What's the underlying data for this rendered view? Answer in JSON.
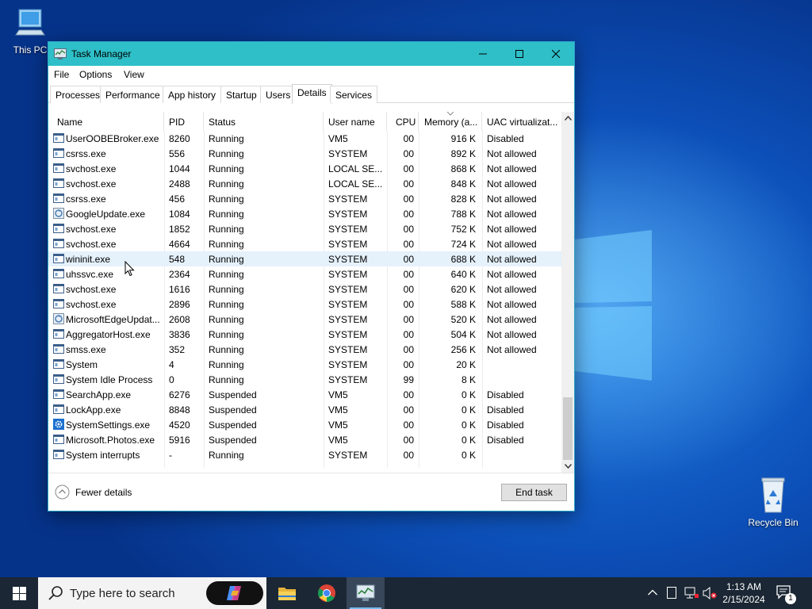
{
  "desktop": {
    "icons": [
      {
        "label": "This PC",
        "icon": "computer-icon"
      },
      {
        "label": "Recycle Bin",
        "icon": "recycle-bin-icon"
      }
    ]
  },
  "window": {
    "title": "Task Manager",
    "accent": "#2ebfc8",
    "menu": [
      "File",
      "Options",
      "View"
    ],
    "tabs": [
      "Processes",
      "Performance",
      "App history",
      "Startup",
      "Users",
      "Details",
      "Services"
    ],
    "active_tab": "Details",
    "columns": [
      "Name",
      "PID",
      "Status",
      "User name",
      "CPU",
      "Memory (a...",
      "UAC virtualizat..."
    ],
    "rows": [
      {
        "name": "UserOOBEBroker.exe",
        "pid": "8260",
        "status": "Running",
        "user": "VM5",
        "cpu": "00",
        "mem": "916 K",
        "uac": "Disabled",
        "icon": "window-icon"
      },
      {
        "name": "csrss.exe",
        "pid": "556",
        "status": "Running",
        "user": "SYSTEM",
        "cpu": "00",
        "mem": "892 K",
        "uac": "Not allowed",
        "icon": "window-icon"
      },
      {
        "name": "svchost.exe",
        "pid": "1044",
        "status": "Running",
        "user": "LOCAL SE...",
        "cpu": "00",
        "mem": "868 K",
        "uac": "Not allowed",
        "icon": "window-icon"
      },
      {
        "name": "svchost.exe",
        "pid": "2488",
        "status": "Running",
        "user": "LOCAL SE...",
        "cpu": "00",
        "mem": "848 K",
        "uac": "Not allowed",
        "icon": "window-icon"
      },
      {
        "name": "csrss.exe",
        "pid": "456",
        "status": "Running",
        "user": "SYSTEM",
        "cpu": "00",
        "mem": "828 K",
        "uac": "Not allowed",
        "icon": "window-icon"
      },
      {
        "name": "GoogleUpdate.exe",
        "pid": "1084",
        "status": "Running",
        "user": "SYSTEM",
        "cpu": "00",
        "mem": "788 K",
        "uac": "Not allowed",
        "icon": "updater-icon"
      },
      {
        "name": "svchost.exe",
        "pid": "1852",
        "status": "Running",
        "user": "SYSTEM",
        "cpu": "00",
        "mem": "752 K",
        "uac": "Not allowed",
        "icon": "window-icon"
      },
      {
        "name": "svchost.exe",
        "pid": "4664",
        "status": "Running",
        "user": "SYSTEM",
        "cpu": "00",
        "mem": "724 K",
        "uac": "Not allowed",
        "icon": "window-icon"
      },
      {
        "name": "wininit.exe",
        "pid": "548",
        "status": "Running",
        "user": "SYSTEM",
        "cpu": "00",
        "mem": "688 K",
        "uac": "Not allowed",
        "icon": "window-icon"
      },
      {
        "name": "uhssvc.exe",
        "pid": "2364",
        "status": "Running",
        "user": "SYSTEM",
        "cpu": "00",
        "mem": "640 K",
        "uac": "Not allowed",
        "icon": "window-icon"
      },
      {
        "name": "svchost.exe",
        "pid": "1616",
        "status": "Running",
        "user": "SYSTEM",
        "cpu": "00",
        "mem": "620 K",
        "uac": "Not allowed",
        "icon": "window-icon"
      },
      {
        "name": "svchost.exe",
        "pid": "2896",
        "status": "Running",
        "user": "SYSTEM",
        "cpu": "00",
        "mem": "588 K",
        "uac": "Not allowed",
        "icon": "window-icon"
      },
      {
        "name": "MicrosoftEdgeUpdat...",
        "pid": "2608",
        "status": "Running",
        "user": "SYSTEM",
        "cpu": "00",
        "mem": "520 K",
        "uac": "Not allowed",
        "icon": "updater-icon"
      },
      {
        "name": "AggregatorHost.exe",
        "pid": "3836",
        "status": "Running",
        "user": "SYSTEM",
        "cpu": "00",
        "mem": "504 K",
        "uac": "Not allowed",
        "icon": "window-icon"
      },
      {
        "name": "smss.exe",
        "pid": "352",
        "status": "Running",
        "user": "SYSTEM",
        "cpu": "00",
        "mem": "256 K",
        "uac": "Not allowed",
        "icon": "window-icon"
      },
      {
        "name": "System",
        "pid": "4",
        "status": "Running",
        "user": "SYSTEM",
        "cpu": "00",
        "mem": "20 K",
        "uac": "",
        "icon": "window-icon"
      },
      {
        "name": "System Idle Process",
        "pid": "0",
        "status": "Running",
        "user": "SYSTEM",
        "cpu": "99",
        "mem": "8 K",
        "uac": "",
        "icon": "window-icon"
      },
      {
        "name": "SearchApp.exe",
        "pid": "6276",
        "status": "Suspended",
        "user": "VM5",
        "cpu": "00",
        "mem": "0 K",
        "uac": "Disabled",
        "icon": "window-icon"
      },
      {
        "name": "LockApp.exe",
        "pid": "8848",
        "status": "Suspended",
        "user": "VM5",
        "cpu": "00",
        "mem": "0 K",
        "uac": "Disabled",
        "icon": "window-icon"
      },
      {
        "name": "SystemSettings.exe",
        "pid": "4520",
        "status": "Suspended",
        "user": "VM5",
        "cpu": "00",
        "mem": "0 K",
        "uac": "Disabled",
        "icon": "gear-icon"
      },
      {
        "name": "Microsoft.Photos.exe",
        "pid": "5916",
        "status": "Suspended",
        "user": "VM5",
        "cpu": "00",
        "mem": "0 K",
        "uac": "Disabled",
        "icon": "window-icon"
      },
      {
        "name": "System interrupts",
        "pid": "-",
        "status": "Running",
        "user": "SYSTEM",
        "cpu": "00",
        "mem": "0 K",
        "uac": "",
        "icon": "window-icon"
      }
    ],
    "hover_row": 8,
    "footer": {
      "fewer_details": "Fewer details",
      "end_task": "End task"
    }
  },
  "taskbar": {
    "search_placeholder": "Type here to search",
    "apps": [
      "file-explorer-icon",
      "chrome-icon",
      "task-manager-icon"
    ],
    "clock_time": "1:13 AM",
    "clock_date": "2/15/2024",
    "notification_count": "1"
  }
}
